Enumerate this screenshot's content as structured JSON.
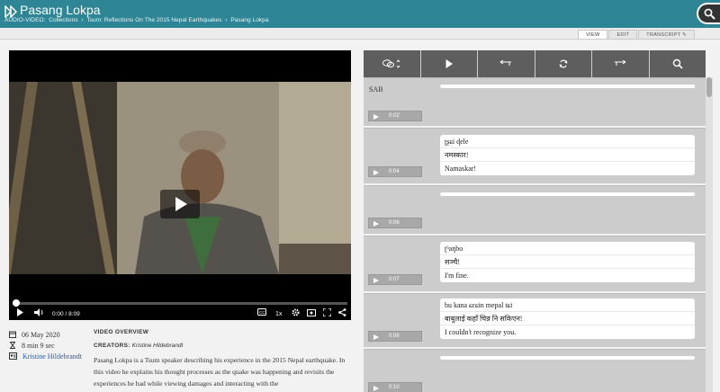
{
  "header": {
    "title": "Pasang Lokpa",
    "breadcrumb": [
      "AUDIO-VIDEO:",
      "Collections",
      "Tsum: Reflections On The 2015 Nepal Earthquakes",
      "Pasang Lokpa"
    ]
  },
  "tabs": [
    {
      "label": "VIEW",
      "active": true
    },
    {
      "label": "EDIT",
      "active": false
    },
    {
      "label": "TRANSCRIPT",
      "active": false
    }
  ],
  "player": {
    "time": "0:00 / 8:09",
    "speed": "1x",
    "progress_fraction": 0
  },
  "meta": {
    "date": "06 May 2020",
    "duration": "8 min 9 sec",
    "creator": "Kristine Hildebrandt"
  },
  "overview": {
    "title": "VIDEO OVERVIEW",
    "creators_label": "CREATORS:",
    "creators_value": "Kristine Hildebrandt",
    "description": "Pasang Lokpa is a Tsum speaker describing his experience in the 2015 Nepal earthquake. In this video he explains his thought processes as the quake was happening and revisits the experiences he had while viewing damages and interacting with the"
  },
  "segments": [
    {
      "label": "SAB",
      "time": "0:02",
      "lines": []
    },
    {
      "label": "",
      "time": "0:04",
      "lines": [
        "ʈʂɕi ɖele",
        "नमस्कार!",
        "Namaskar!"
      ]
    },
    {
      "label": "",
      "time": "0:06",
      "lines": []
    },
    {
      "label": "",
      "time": "0:07",
      "lines": [
        "ʈʰaŋbo",
        "सञ्चै!",
        "I'm fine."
      ]
    },
    {
      "label": "",
      "time": "0:08",
      "lines": [
        "bu kana ɕɛɕin mepal tɕi",
        "बाबुलाई कहाँ चिन्न नि सकिएन!",
        "I couldn't recognize you."
      ]
    },
    {
      "label": "",
      "time": "0:10",
      "lines": []
    }
  ],
  "colors": {
    "header": "#2e8596",
    "toolbar": "#5e5e5e",
    "segment_bg": "#cccccc",
    "link": "#2a5caa"
  }
}
